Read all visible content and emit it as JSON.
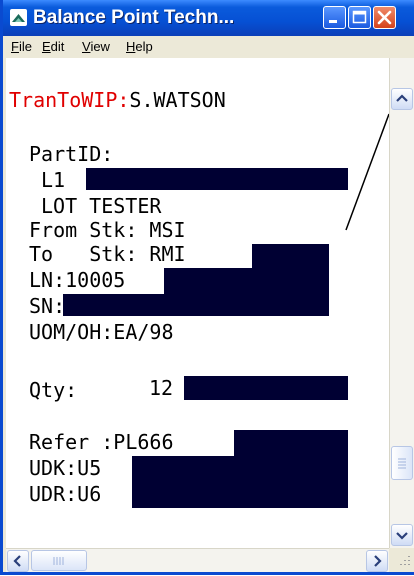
{
  "window": {
    "title": "Balance Point Techn..."
  },
  "menu": {
    "file": "File",
    "edit": "Edit",
    "view": "View",
    "help": "Help"
  },
  "screen": {
    "header_prefix": "TranToWIP:",
    "header_user": "S.WATSON",
    "part_id_label": "PartID:",
    "part_id_value": "L1",
    "part_desc": "LOT TESTER",
    "from_stk": "From Stk: MSI",
    "to_stk": "To   Stk: RMI",
    "ln": "LN:10005",
    "sn": "SN:",
    "uom_oh": "UOM/OH:EA/98",
    "qty_label": "Qty:",
    "qty_value": "12",
    "refer": "Refer :PL666",
    "udk": "UDK:U5",
    "udr": "UDR:U6"
  },
  "icons": {
    "app": "balance-point-icon",
    "minimize": "minimize-icon",
    "maximize": "maximize-icon",
    "close": "close-icon",
    "scroll_up": "arrow-up-icon",
    "scroll_down": "arrow-down-icon",
    "scroll_left": "arrow-left-icon",
    "scroll_right": "arrow-right-icon"
  },
  "colors": {
    "title_bar": "#0a5bdc",
    "header_text": "#e00000",
    "redaction": "#000033"
  }
}
